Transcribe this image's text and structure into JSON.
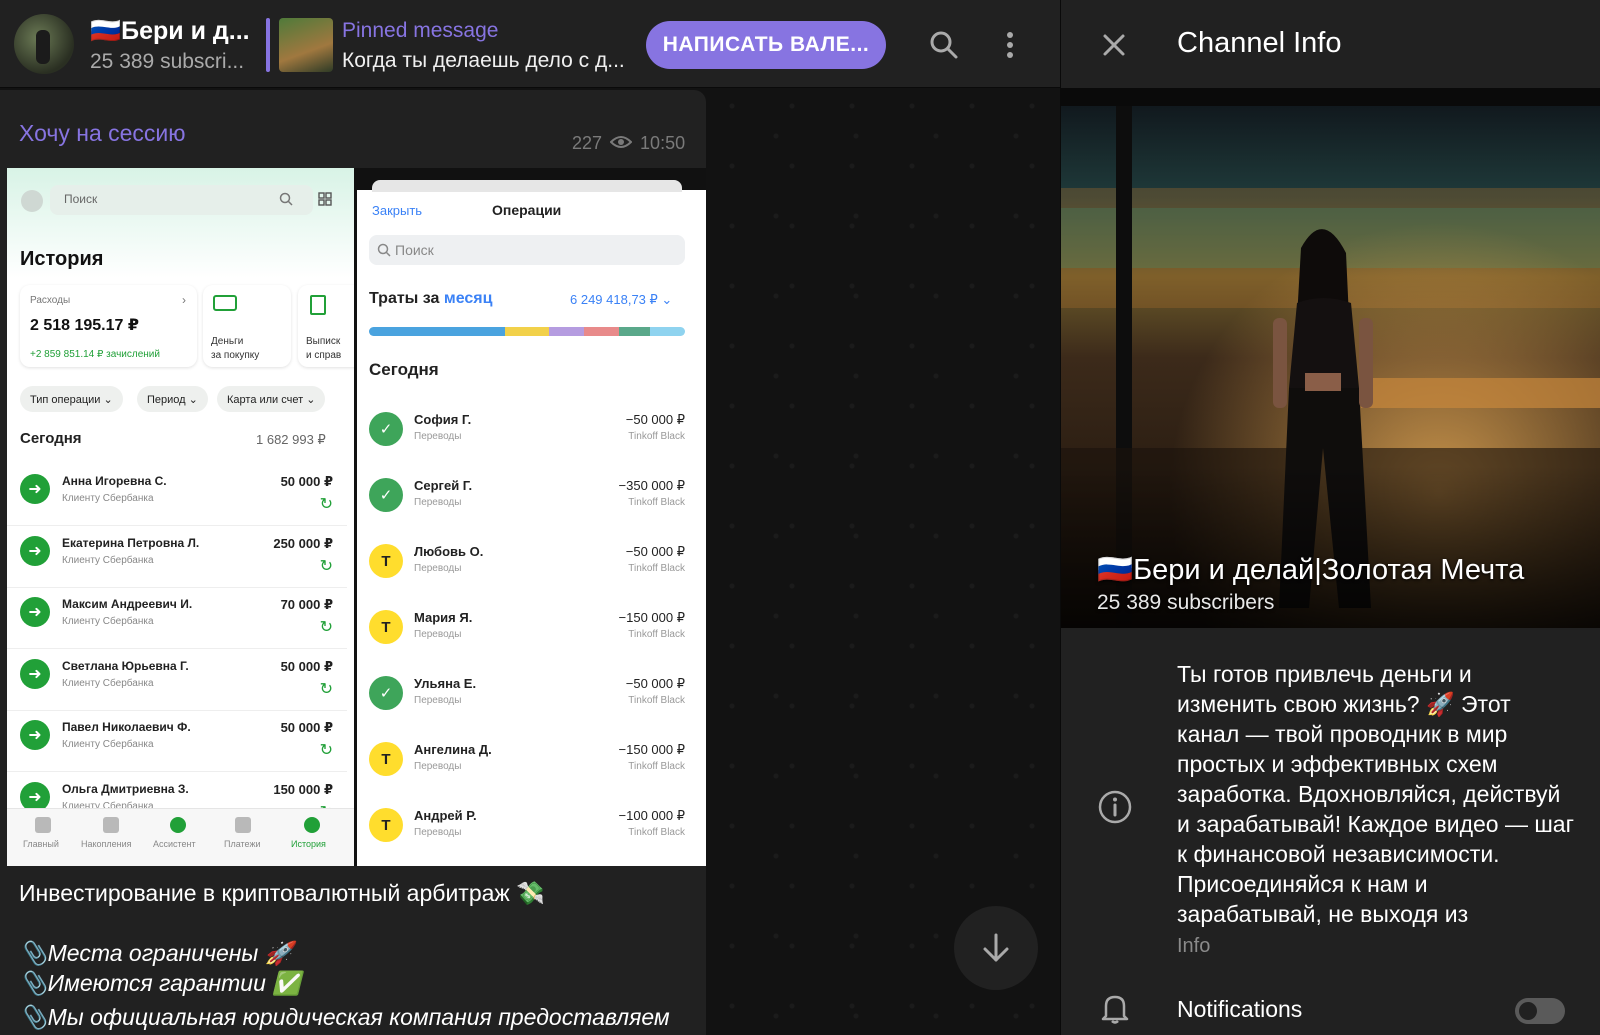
{
  "header": {
    "channel_title": "🇷🇺Бери и д...",
    "channel_subscribers": "25 389 subscri...",
    "pinned_label": "Pinned message",
    "pinned_text": "Когда ты делаешь дело с д...",
    "write_button": "НАПИСАТЬ ВАЛЕ..."
  },
  "message": {
    "reply_link": "Хочу на сессию",
    "views": "227",
    "time": "10:50",
    "caption_title": "Инвестирование в криптовалютный арбитраж 💸",
    "caption_lines": [
      "📎Места ограничены 🚀",
      "📎Имеются гарантии ✅",
      "📎Мы официальная юридическая компания предоставляем"
    ]
  },
  "phone1": {
    "search_placeholder": "Поиск",
    "heading": "История",
    "expenses_label": "Расходы",
    "expenses_value": "2 518 195.17 ₽",
    "credits_text": "+2 859 851.14 ₽ зачислений",
    "card2_label": "Деньги\nза покупку",
    "card3_label": "Выписк\nи справ",
    "chips": [
      "Тип операции ⌄",
      "Период ⌄",
      "Карта или счет ⌄"
    ],
    "today_label": "Сегодня",
    "today_sum": "1 682 993 ₽",
    "rows": [
      {
        "name": "Анна Игоревна С.",
        "desc": "Клиенту Сбербанка",
        "amount": "50 000 ₽"
      },
      {
        "name": "Екатерина Петровна Л.",
        "desc": "Клиенту Сбербанка",
        "amount": "250 000 ₽"
      },
      {
        "name": "Максим Андреевич И.",
        "desc": "Клиенту Сбербанка",
        "amount": "70 000 ₽"
      },
      {
        "name": "Светлана Юрьевна Г.",
        "desc": "Клиенту Сбербанка",
        "amount": "50 000 ₽"
      },
      {
        "name": "Павел Николаевич Ф.",
        "desc": "Клиенту Сбербанка",
        "amount": "50 000 ₽"
      },
      {
        "name": "Ольга Дмитриевна З.",
        "desc": "Клиенту Сбербанка",
        "amount": "150 000 ₽"
      }
    ],
    "nav": [
      "Главный",
      "Накопления",
      "Ассистент",
      "Платежи",
      "История"
    ]
  },
  "phone2": {
    "close_label": "Закрыть",
    "title": "Операции",
    "search_placeholder": "Поиск",
    "spend_prefix": "Траты за ",
    "spend_period": "месяц",
    "spend_total": "6 249 418,73 ₽ ⌄",
    "bar_colors": [
      "#4aa3df",
      "#f2d14a",
      "#b59ce0",
      "#e88a8a",
      "#5aa88a",
      "#8fd3ef"
    ],
    "today_label": "Сегодня",
    "rows": [
      {
        "name": "София Г.",
        "desc": "Переводы",
        "amount": "−50 000 ₽",
        "card": "Tinkoff Black",
        "icon": "g"
      },
      {
        "name": "Сергей Г.",
        "desc": "Переводы",
        "amount": "−350 000 ₽",
        "card": "Tinkoff Black",
        "icon": "g"
      },
      {
        "name": "Любовь О.",
        "desc": "Переводы",
        "amount": "−50 000 ₽",
        "card": "Tinkoff Black",
        "icon": "y"
      },
      {
        "name": "Мария Я.",
        "desc": "Переводы",
        "amount": "−150 000 ₽",
        "card": "Tinkoff Black",
        "icon": "y"
      },
      {
        "name": "Ульяна Е.",
        "desc": "Переводы",
        "amount": "−50 000 ₽",
        "card": "Tinkoff Black",
        "icon": "g"
      },
      {
        "name": "Ангелина Д.",
        "desc": "Переводы",
        "amount": "−150 000 ₽",
        "card": "Tinkoff Black",
        "icon": "y"
      },
      {
        "name": "Андрей Р.",
        "desc": "Переводы",
        "amount": "−100 000 ₽",
        "card": "Tinkoff Black",
        "icon": "y"
      }
    ]
  },
  "info_panel": {
    "title": "Channel Info",
    "channel_name": "🇷🇺Бери и делай|Золотая Мечта",
    "subscribers": "25 389 subscribers",
    "description": "Ты готов привлечь деньги и изменить свою жизнь? 🚀 Этот канал — твой проводник в мир простых и эффективных схем заработка. Вдохновляйся, действуй и зарабатывай! Каждое видео — шаг к финансовой независимости. Присоединяйся к нам и зарабатывай, не выходя из",
    "description_label": "Info",
    "notifications_label": "Notifications",
    "notifications_on": false
  },
  "colors": {
    "accent": "#8774e1",
    "panel": "#212121",
    "sber_green": "#21a038",
    "tinkoff_yellow": "#ffdd2d"
  }
}
